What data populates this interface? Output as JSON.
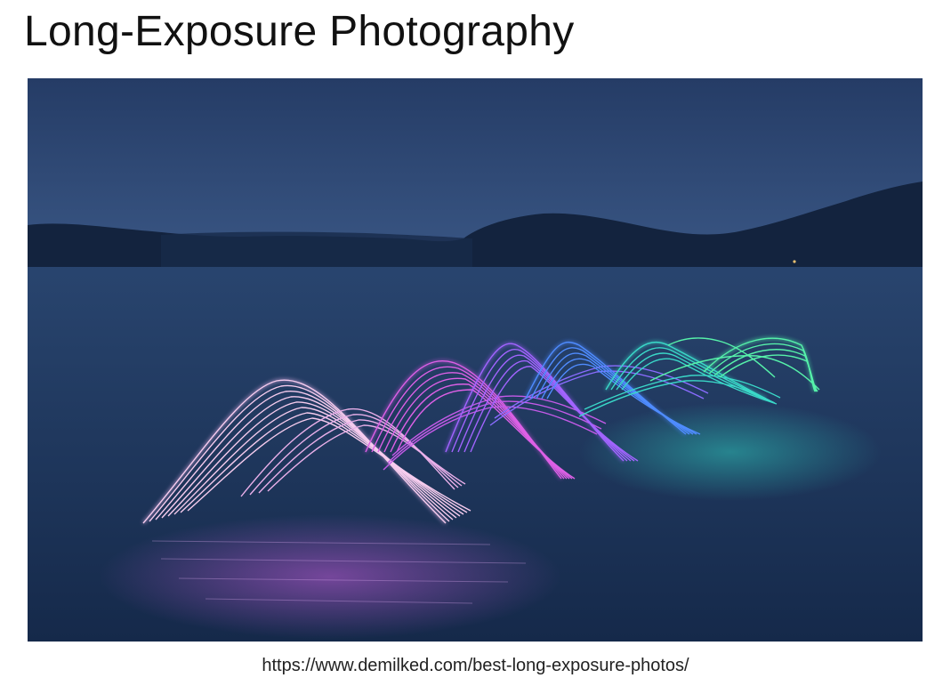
{
  "slide": {
    "title": "Long-Exposure Photography",
    "source_url": "https://www.demilked.com/best-long-exposure-photos/"
  },
  "photo": {
    "subject": "light trails over lake at dusk",
    "colors": {
      "sky_top": "#27406a",
      "sky_bottom": "#33507c",
      "hills": "#13233d",
      "water": "#1b3357",
      "trail_pink": "#f5c8ec",
      "trail_magenta": "#d24ce0",
      "trail_violet": "#9a5cff",
      "trail_blue": "#4a7dff",
      "trail_teal": "#2fd6c8",
      "trail_green": "#48f0a0"
    }
  }
}
